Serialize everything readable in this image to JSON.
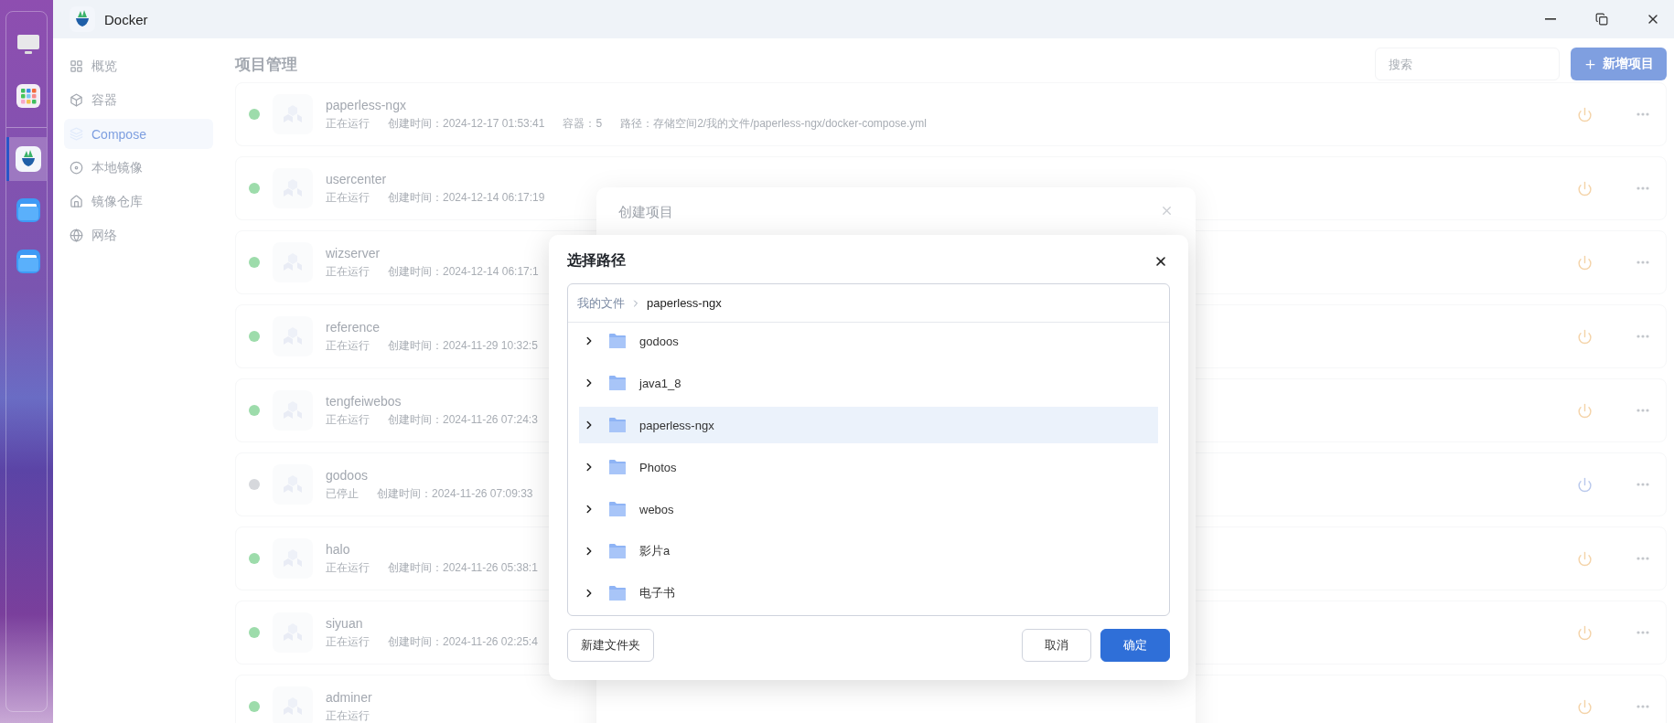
{
  "window": {
    "title": "Docker"
  },
  "dock": {
    "items": [
      {
        "kind": "monitor",
        "selected": false
      },
      {
        "kind": "apps",
        "selected": false
      },
      {
        "kind": "docker",
        "selected": true
      },
      {
        "kind": "folder",
        "selected": false
      },
      {
        "kind": "folder",
        "selected": false
      }
    ]
  },
  "nav": {
    "items": [
      {
        "kind": "overview",
        "label": "概览",
        "selected": false
      },
      {
        "kind": "container",
        "label": "容器",
        "selected": false
      },
      {
        "kind": "compose",
        "label": "Compose",
        "selected": true
      },
      {
        "kind": "image",
        "label": "本地镜像",
        "selected": false
      },
      {
        "kind": "registry",
        "label": "镜像仓库",
        "selected": false
      },
      {
        "kind": "network",
        "label": "网络",
        "selected": false
      }
    ]
  },
  "main": {
    "title": "项目管理",
    "search": {
      "placeholder": "搜索"
    },
    "add_button": "新增项目",
    "projects": [
      {
        "name": "paperless-ngx",
        "running": true,
        "status": "正在运行",
        "details": [
          "创建时间：2024-12-17 01:53:41",
          "容器：5",
          "路径：存储空间2/我的文件/paperless-ngx/docker-compose.yml"
        ]
      },
      {
        "name": "usercenter",
        "running": true,
        "status": "正在运行",
        "details": [
          "创建时间：2024-12-14 06:17:19"
        ]
      },
      {
        "name": "wizserver",
        "running": true,
        "status": "正在运行",
        "details": [
          "创建时间：2024-12-14 06:17:1"
        ]
      },
      {
        "name": "reference",
        "running": true,
        "status": "正在运行",
        "details": [
          "创建时间：2024-11-29 10:32:5"
        ]
      },
      {
        "name": "tengfeiwebos",
        "running": true,
        "status": "正在运行",
        "details": [
          "创建时间：2024-11-26 07:24:3"
        ]
      },
      {
        "name": "godoos",
        "running": false,
        "status": "已停止",
        "details": [
          "创建时间：2024-11-26 07:09:33"
        ]
      },
      {
        "name": "halo",
        "running": true,
        "status": "正在运行",
        "details": [
          "创建时间：2024-11-26 05:38:1"
        ]
      },
      {
        "name": "siyuan",
        "running": true,
        "status": "正在运行",
        "details": [
          "创建时间：2024-11-26 02:25:4"
        ]
      },
      {
        "name": "adminer",
        "running": true,
        "status": "正在运行"
      }
    ]
  },
  "create_dialog": {
    "title": "创建项目"
  },
  "path_dialog": {
    "title": "选择路径",
    "breadcrumb": [
      {
        "label": "我的文件",
        "current": false
      },
      {
        "label": "paperless-ngx",
        "current": true
      }
    ],
    "folders": [
      {
        "name": "godoos",
        "selected": false
      },
      {
        "name": "java1_8",
        "selected": false
      },
      {
        "name": "paperless-ngx",
        "selected": true
      },
      {
        "name": "Photos",
        "selected": false
      },
      {
        "name": "webos",
        "selected": false
      },
      {
        "name": "影片a",
        "selected": false
      },
      {
        "name": "电子书",
        "selected": false
      }
    ],
    "new_folder_button": "新建文件夹",
    "cancel_button": "取消",
    "ok_button": "确定"
  }
}
